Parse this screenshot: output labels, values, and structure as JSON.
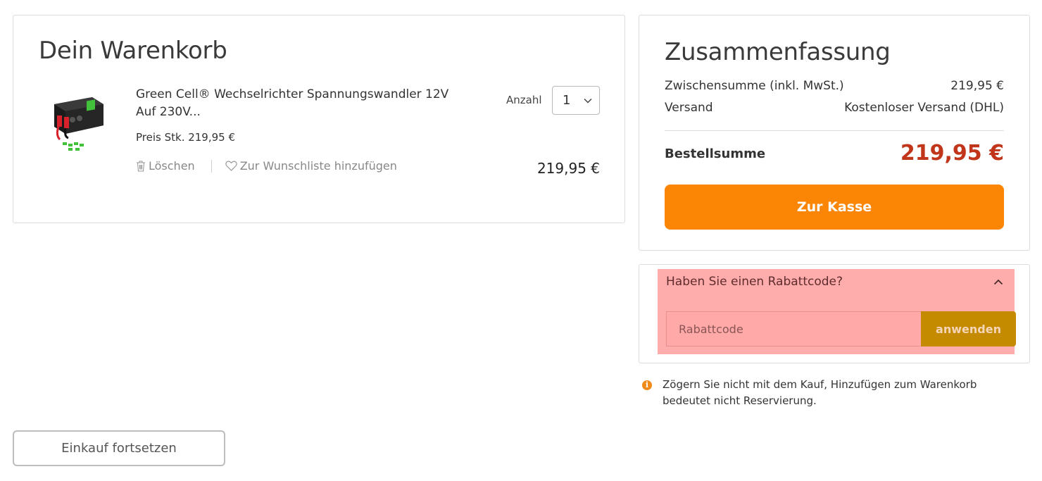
{
  "cart": {
    "title": "Dein Warenkorb",
    "item": {
      "name": "Green Cell® Wechselrichter Spannungswandler 12V Auf 230V...",
      "unit_price": "Preis Stk. 219,95 €",
      "quantity_label": "Anzahl",
      "quantity": "1",
      "delete_label": "Löschen",
      "wishlist_label": "Zur Wunschliste hinzufügen",
      "line_total": "219,95 €"
    },
    "continue_label": "Einkauf fortsetzen"
  },
  "summary": {
    "title": "Zusammenfassung",
    "subtotal_label": "Zwischensumme (inkl. MwSt.)",
    "subtotal_value": "219,95 €",
    "shipping_label": "Versand",
    "shipping_value": "Kostenloser Versand (DHL)",
    "total_label": "Bestellsumme",
    "total_value": "219,95 €",
    "checkout_label": "Zur Kasse"
  },
  "coupon": {
    "question": "Haben Sie einen Rabattcode?",
    "placeholder": "Rabattcode",
    "apply_label": "anwenden"
  },
  "notice": {
    "text": "Zögern Sie nicht mit dem Kauf, Hinzufügen zum Warenkorb bedeutet nicht Reservierung."
  },
  "colors": {
    "accent_orange": "#fb8505",
    "total_red": "#c1361a",
    "highlight_pink": "#ffacac",
    "apply_gold": "#c48a00"
  },
  "icons": {
    "delete": "trash-icon",
    "wishlist": "heart-icon",
    "quantity": "chevron-down-icon",
    "coupon_toggle": "chevron-up-icon",
    "notice": "info-icon"
  }
}
